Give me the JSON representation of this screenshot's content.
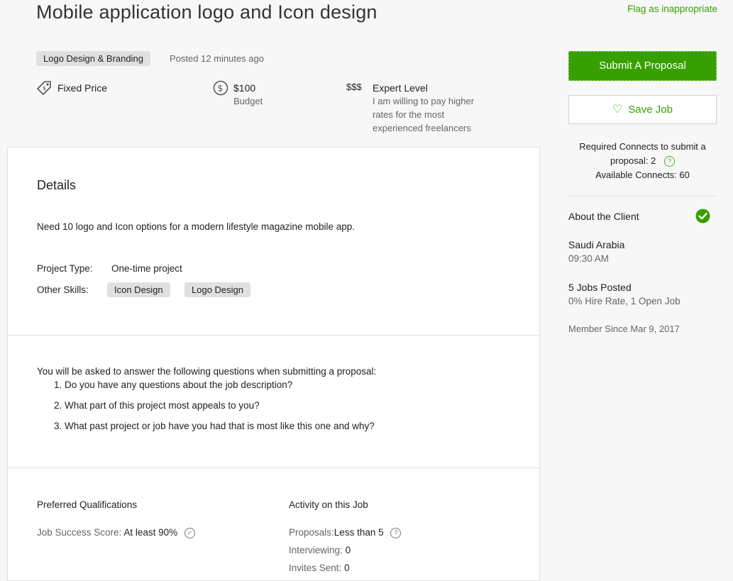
{
  "header": {
    "title": "Mobile application logo and Icon design",
    "flag_label": "Flag as inappropriate"
  },
  "meta": {
    "category_tag": "Logo Design & Branding",
    "posted": "Posted 12 minutes ago",
    "price_type": "Fixed Price",
    "budget_value": "$100",
    "budget_label": "Budget",
    "level_symbol": "$$$",
    "level_title": "Expert Level",
    "level_desc_1": "I am willing to pay higher",
    "level_desc_2": "rates for the most",
    "level_desc_3": "experienced freelancers"
  },
  "details": {
    "heading": "Details",
    "description": "Need 10 logo and Icon options for a modern lifestyle magazine mobile app.",
    "project_type_label": "Project Type:",
    "project_type_value": "One-time project",
    "other_skills_label": "Other Skills:",
    "skills": [
      "Icon Design",
      "Logo Design"
    ]
  },
  "questions": {
    "intro": "You will be asked to answer the following questions when submitting a proposal:",
    "items": [
      "1. Do you have any questions about the job description?",
      "2. What part of this project most appeals to you?",
      "3. What past project or job have you had that is most like this one and why?"
    ]
  },
  "qualifications": {
    "heading": "Preferred Qualifications",
    "jss_label": "Job Success Score:",
    "jss_value": "At least 90%"
  },
  "activity": {
    "heading": "Activity on this Job",
    "proposals_label": "Proposals:",
    "proposals_value": "Less than 5",
    "interviewing_label": "Interviewing:",
    "interviewing_value": "0",
    "invites_label": "Invites Sent:",
    "invites_value": "0"
  },
  "sidebar": {
    "submit_label": "Submit A Proposal",
    "save_label": "Save Job",
    "connects_line1": "Required Connects to submit a",
    "connects_line2": "proposal: 2",
    "connects_line3": "Available Connects: 60",
    "about_client": "About the Client",
    "country": "Saudi Arabia",
    "local_time": "09:30 AM",
    "jobs_posted": "5 Jobs Posted",
    "hire_rate": "0% Hire Rate, 1 Open Job",
    "member_since": "Member Since Mar 9, 2017"
  },
  "colors": {
    "accent": "#37a000",
    "muted_text": "#656565",
    "tag_bg": "#e0e0e0"
  }
}
